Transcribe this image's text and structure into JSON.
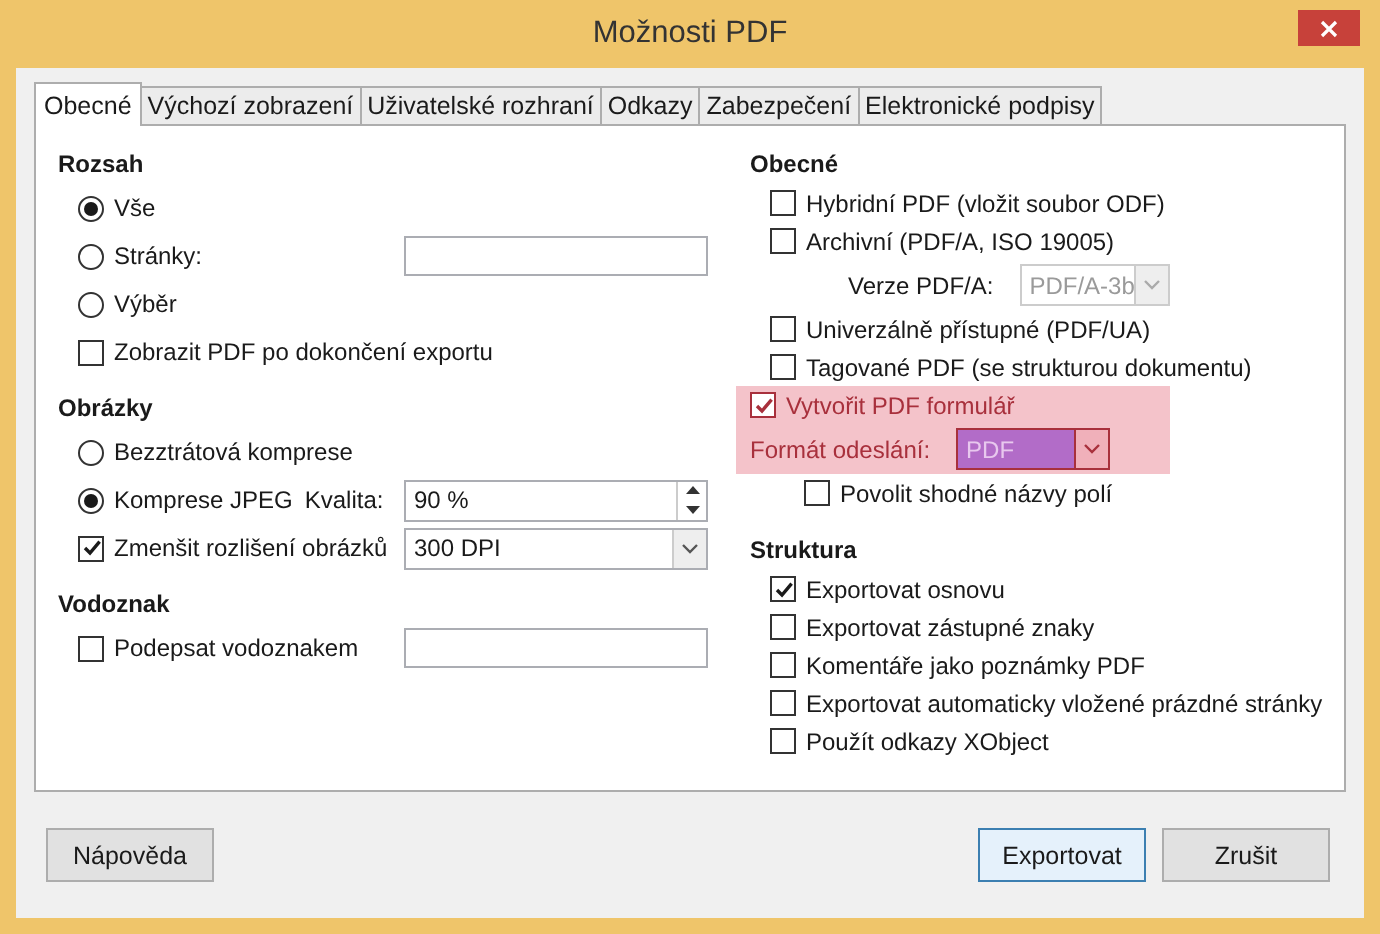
{
  "window": {
    "title": "Možnosti PDF"
  },
  "tabs": [
    {
      "label": "Obecné",
      "selected": true
    },
    {
      "label": "Výchozí zobrazení",
      "selected": false
    },
    {
      "label": "Uživatelské rozhraní",
      "selected": false
    },
    {
      "label": "Odkazy",
      "selected": false
    },
    {
      "label": "Zabezpečení",
      "selected": false
    },
    {
      "label": "Elektronické podpisy",
      "selected": false
    }
  ],
  "left_column": [
    {
      "title": "Rozsah",
      "items": [
        {
          "kind": "radio",
          "label": "Vše",
          "selected": true
        },
        {
          "kind": "radio",
          "label": "Stránky:",
          "selected": false,
          "control": {
            "kind": "text"
          }
        },
        {
          "kind": "radio",
          "label": "Výběr",
          "selected": false
        },
        {
          "kind": "checkbox",
          "label": "Zobrazit PDF po dokončení exportu",
          "checked": false
        }
      ]
    },
    {
      "title": "Obrázky",
      "items": [
        {
          "kind": "radio",
          "label": "Bezztrátová komprese",
          "selected": false
        },
        {
          "kind": "radio",
          "label": "Komprese JPEG",
          "sublabel": "Kvalita:",
          "selected": true,
          "control": {
            "kind": "spin",
            "value": "90 %"
          }
        },
        {
          "kind": "checkbox",
          "label": "Zmenšit rozlišení obrázků",
          "checked": true,
          "control": {
            "kind": "select",
            "value": "300 DPI",
            "disabled": false,
            "selected": false
          }
        }
      ]
    },
    {
      "title": "Vodoznak",
      "items": [
        {
          "kind": "checkbox",
          "label": "Podepsat vodoznakem",
          "checked": false,
          "control": {
            "kind": "text"
          }
        }
      ]
    }
  ],
  "right_column": [
    {
      "title": "Obecné",
      "items": [
        {
          "kind": "checkbox",
          "label": "Hybridní PDF (vložit soubor ODF)",
          "checked": false,
          "highlighted": false
        },
        {
          "kind": "checkbox",
          "label": "Archivní (PDF/A, ISO 19005)",
          "checked": false,
          "highlighted": false,
          "children": [
            {
              "kind": "label",
              "label": "Verze PDF/A:",
              "highlighted": false,
              "control": {
                "kind": "select",
                "value": "PDF/A-3b",
                "disabled": true,
                "selected": false
              }
            }
          ]
        },
        {
          "kind": "checkbox",
          "label": "Univerzálně přístupné (PDF/UA)",
          "checked": false,
          "highlighted": false
        },
        {
          "kind": "checkbox",
          "label": "Tagované PDF (se strukturou dokumentu)",
          "checked": false,
          "highlighted": false
        },
        {
          "kind": "checkbox",
          "label": "Vytvořit PDF formulář",
          "checked": true,
          "highlighted": true,
          "children": [
            {
              "kind": "label",
              "label": "Formát odeslání:",
              "highlighted": true,
              "control": {
                "kind": "select",
                "value": "PDF",
                "disabled": false,
                "selected": true
              }
            },
            {
              "kind": "checkbox",
              "label": "Povolit shodné názvy polí",
              "checked": false,
              "highlighted": false
            }
          ]
        }
      ]
    },
    {
      "title": "Struktura",
      "items": [
        {
          "kind": "checkbox",
          "label": "Exportovat osnovu",
          "checked": true,
          "highlighted": false
        },
        {
          "kind": "checkbox",
          "label": "Exportovat zástupné znaky",
          "checked": false,
          "highlighted": false
        },
        {
          "kind": "checkbox",
          "label": "Komentáře jako poznámky PDF",
          "checked": false,
          "highlighted": false
        },
        {
          "kind": "checkbox",
          "label": "Exportovat automaticky vložené prázdné stránky",
          "checked": false,
          "highlighted": false
        },
        {
          "kind": "checkbox",
          "label": "Použít odkazy XObject",
          "checked": false,
          "highlighted": false
        }
      ]
    }
  ],
  "buttons": [
    {
      "label": "Nápověda",
      "default": false
    },
    {
      "label": "Exportovat",
      "default": true
    },
    {
      "label": "Zrušit",
      "default": false
    }
  ]
}
